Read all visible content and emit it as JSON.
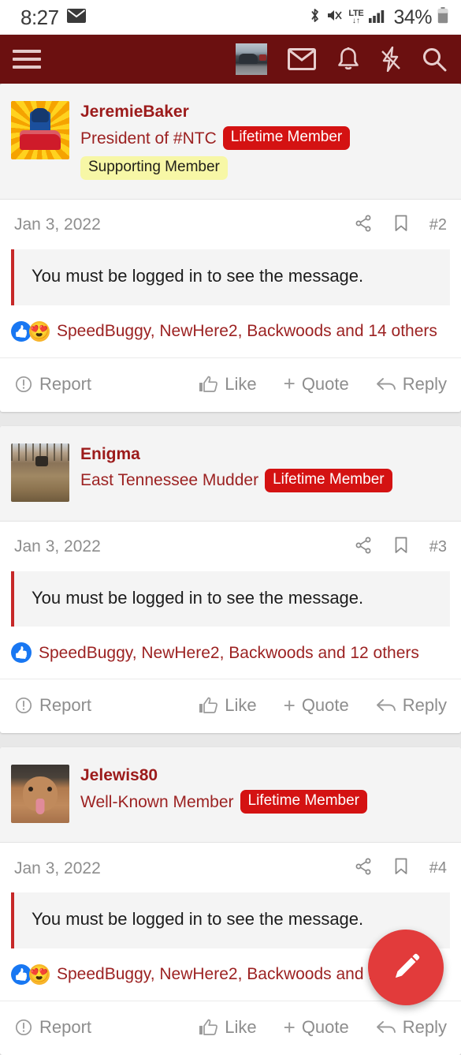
{
  "status_bar": {
    "time": "8:27",
    "mail_icon": "envelope-icon",
    "bluetooth_icon": "bluetooth-icon",
    "mute_icon": "speaker-mute-icon",
    "network_label": "LTE",
    "network_arrows": "↓↑",
    "signal_icon": "signal-bars-icon",
    "battery_percent": "34%",
    "battery_icon": "battery-icon"
  },
  "header": {
    "menu_icon": "hamburger-menu-icon",
    "avatar_icon": "user-avatar-thumbnail",
    "inbox_icon": "envelope-icon",
    "alerts_icon": "bell-icon",
    "whats_new_icon": "lightning-bolt-icon",
    "search_icon": "search-icon",
    "background_color": "#6b1010"
  },
  "posts": [
    {
      "avatar_icon": "lego-racer-avatar",
      "username": "JeremieBaker",
      "user_title": "President of #NTC",
      "badges": [
        {
          "label": "Lifetime Member",
          "style": "lifetime"
        },
        {
          "label": "Supporting Member",
          "style": "supporting"
        }
      ],
      "date": "Jan 3, 2022",
      "share_icon": "share-icon",
      "bookmark_icon": "bookmark-icon",
      "post_number": "#2",
      "message": "You must be logged in to see the message.",
      "reactions": {
        "emojis": [
          "like",
          "love"
        ],
        "text": "SpeedBuggy, NewHere2, Backwoods and 14 others"
      },
      "actions": {
        "report": "Report",
        "like": "Like",
        "quote": "Quote",
        "reply": "Reply"
      }
    },
    {
      "avatar_icon": "muddy-trail-avatar",
      "username": "Enigma",
      "user_title": "East Tennessee Mudder",
      "badges": [
        {
          "label": "Lifetime Member",
          "style": "lifetime"
        }
      ],
      "date": "Jan 3, 2022",
      "share_icon": "share-icon",
      "bookmark_icon": "bookmark-icon",
      "post_number": "#3",
      "message": "You must be logged in to see the message.",
      "reactions": {
        "emojis": [
          "like"
        ],
        "text": "SpeedBuggy, NewHere2, Backwoods and 12 others"
      },
      "actions": {
        "report": "Report",
        "like": "Like",
        "quote": "Quote",
        "reply": "Reply"
      }
    },
    {
      "avatar_icon": "dog-photo-avatar",
      "username": "Jelewis80",
      "user_title": "Well-Known Member",
      "badges": [
        {
          "label": "Lifetime Member",
          "style": "lifetime"
        }
      ],
      "date": "Jan 3, 2022",
      "share_icon": "share-icon",
      "bookmark_icon": "bookmark-icon",
      "post_number": "#4",
      "message": "You must be logged in to see the message.",
      "reactions": {
        "emojis": [
          "like",
          "love"
        ],
        "text": "SpeedBuggy, NewHere2, Backwoods and 15 others"
      },
      "actions": {
        "report": "Report",
        "like": "Like",
        "quote": "Quote",
        "reply": "Reply"
      }
    }
  ],
  "fab": {
    "icon": "pencil-compose-icon",
    "color": "#e23b3b"
  },
  "colors": {
    "header": "#6b1010",
    "badge_lifetime": "#d41212",
    "badge_supporting": "#f7f7a6",
    "username": "#9c1b1b",
    "quote_border": "#c62828"
  }
}
